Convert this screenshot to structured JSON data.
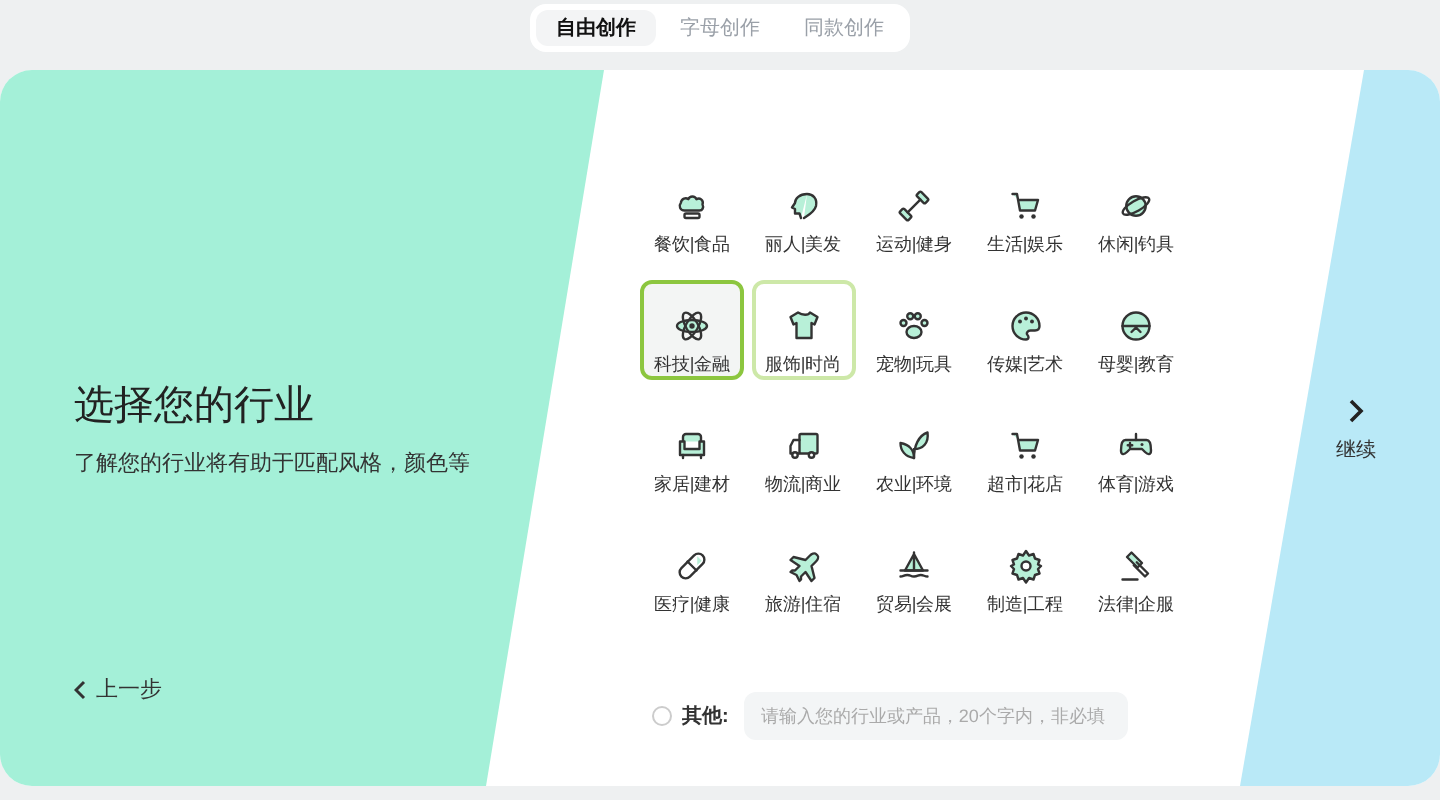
{
  "tabs": [
    {
      "label": "自由创作",
      "selected": true
    },
    {
      "label": "字母创作",
      "selected": false
    },
    {
      "label": "同款创作",
      "selected": false
    }
  ],
  "intro": {
    "title": "选择您的行业",
    "subtitle": "了解您的行业将有助于匹配风格，颜色等",
    "back": "上一步"
  },
  "industries": [
    {
      "label": "餐饮|食品",
      "selected": false,
      "hovered": false
    },
    {
      "label": "丽人|美发",
      "selected": false,
      "hovered": false
    },
    {
      "label": "运动|健身",
      "selected": false,
      "hovered": false
    },
    {
      "label": "生活|娱乐",
      "selected": false,
      "hovered": false
    },
    {
      "label": "休闲|钓具",
      "selected": false,
      "hovered": false
    },
    {
      "label": "科技|金融",
      "selected": true,
      "hovered": false
    },
    {
      "label": "服饰|时尚",
      "selected": false,
      "hovered": true
    },
    {
      "label": "宠物|玩具",
      "selected": false,
      "hovered": false
    },
    {
      "label": "传媒|艺术",
      "selected": false,
      "hovered": false
    },
    {
      "label": "母婴|教育",
      "selected": false,
      "hovered": false
    },
    {
      "label": "家居|建材",
      "selected": false,
      "hovered": false
    },
    {
      "label": "物流|商业",
      "selected": false,
      "hovered": false
    },
    {
      "label": "农业|环境",
      "selected": false,
      "hovered": false
    },
    {
      "label": "超市|花店",
      "selected": false,
      "hovered": false
    },
    {
      "label": "体育|游戏",
      "selected": false,
      "hovered": false
    },
    {
      "label": "医疗|健康",
      "selected": false,
      "hovered": false
    },
    {
      "label": "旅游|住宿",
      "selected": false,
      "hovered": false
    },
    {
      "label": "贸易|会展",
      "selected": false,
      "hovered": false
    },
    {
      "label": "制造|工程",
      "selected": false,
      "hovered": false
    },
    {
      "label": "法律|企服",
      "selected": false,
      "hovered": false
    }
  ],
  "other": {
    "label": "其他:",
    "checked": false,
    "placeholder": "请输入您的行业或产品，20个字内，非必填"
  },
  "next": {
    "label": "继续"
  }
}
